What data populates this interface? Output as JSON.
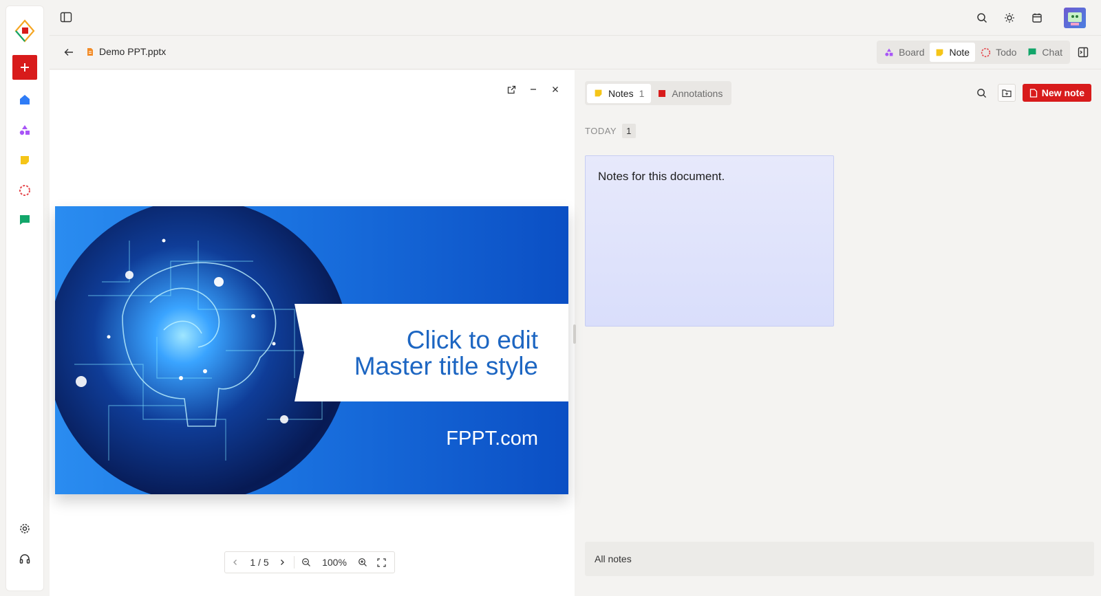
{
  "colors": {
    "accent_red": "#d81b1b",
    "home_blue": "#2f7cf6",
    "board_purple": "#a855f7",
    "note_yellow": "#f5c518",
    "todo_red": "#e5484d",
    "chat_green": "#12a66a",
    "note_card_bg": "#e2e5fb"
  },
  "sidebar": {
    "items": [
      {
        "icon": "logo-icon"
      },
      {
        "icon": "plus-icon",
        "label": "New"
      },
      {
        "icon": "home-icon"
      },
      {
        "icon": "board-icon"
      },
      {
        "icon": "note-icon"
      },
      {
        "icon": "todo-icon"
      },
      {
        "icon": "chat-icon"
      }
    ],
    "bottom": [
      {
        "icon": "gear-icon"
      },
      {
        "icon": "headset-icon"
      }
    ]
  },
  "topbar": {
    "left": [
      "sidebar-toggle-icon"
    ],
    "right": [
      "search-icon",
      "sun-icon",
      "calendar-icon",
      "avatar"
    ]
  },
  "file": {
    "back_icon": "arrow-left-icon",
    "name": "Demo PPT.pptx"
  },
  "mode_tabs": [
    {
      "label": "Board",
      "icon": "board-icon",
      "active": false
    },
    {
      "label": "Note",
      "icon": "note-icon",
      "active": true
    },
    {
      "label": "Todo",
      "icon": "todo-icon",
      "active": false
    },
    {
      "label": "Chat",
      "icon": "chat-icon",
      "active": false
    }
  ],
  "viewer": {
    "tools": [
      "external-link-icon",
      "minimize-icon",
      "close-icon"
    ],
    "slide": {
      "title": "Click to edit\nMaster title style",
      "footer": "FPPT.com"
    },
    "pager": {
      "page": "1 / 5",
      "zoom": "100%"
    }
  },
  "notes_panel": {
    "tabs": [
      {
        "label": "Notes",
        "count": "1",
        "active": true
      },
      {
        "label": "Annotations",
        "count": "",
        "active": false
      }
    ],
    "new_note_label": "New note",
    "group": {
      "label": "TODAY",
      "count": "1"
    },
    "notes": [
      {
        "text": "Notes for this document."
      }
    ],
    "all_notes_label": "All notes"
  }
}
